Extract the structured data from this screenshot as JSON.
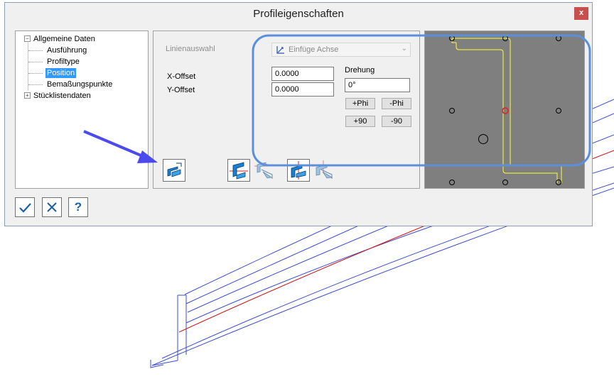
{
  "dialog": {
    "title": "Profileigenschaften",
    "close_label": "x"
  },
  "tree": {
    "items": [
      {
        "label": "Allgemeine Daten",
        "expander": "−"
      },
      {
        "label": "Ausführung"
      },
      {
        "label": "Profiltype"
      },
      {
        "label": "Position",
        "selected": true
      },
      {
        "label": "Bemaßungspunkte"
      },
      {
        "label": "Stücklistendaten",
        "expander": "+"
      }
    ]
  },
  "position": {
    "linienauswahl_label": "Linienauswahl",
    "linienauswahl_value": "Einfüge Achse",
    "linienauswahl_icon": "axis-icon",
    "x_offset_label": "X-Offset",
    "x_offset_value": "0.0000",
    "y_offset_label": "Y-Offset",
    "y_offset_value": "0.0000",
    "drehung_label": "Drehung",
    "drehung_value": "0°",
    "buttons": {
      "plus_phi": "+Phi",
      "minus_phi": "-Phi",
      "plus_90": "+90",
      "minus_90": "-90"
    },
    "tools": [
      {
        "icon": "profile-swap-icon",
        "state": "normal"
      },
      {
        "icon": "mirror-horizontal-icon",
        "state": "normal"
      },
      {
        "icon": "mirror-horizontal-disabled-icon",
        "state": "disabled"
      },
      {
        "icon": "mirror-vertical-icon",
        "state": "normal"
      },
      {
        "icon": "mirror-vertical-disabled-icon",
        "state": "disabled"
      }
    ]
  },
  "preview": {
    "background": "#7f7f7f",
    "profile_color": "#ffff33",
    "selected_point_color": "#e02020"
  },
  "footer": {
    "ok_icon": "checkmark-icon",
    "cancel_icon": "cancel-icon",
    "help_icon": "help-icon",
    "help_label": "?"
  },
  "annotations": {
    "arrow_color": "#4a4aee",
    "highlight_color": "#5b8fdb"
  }
}
